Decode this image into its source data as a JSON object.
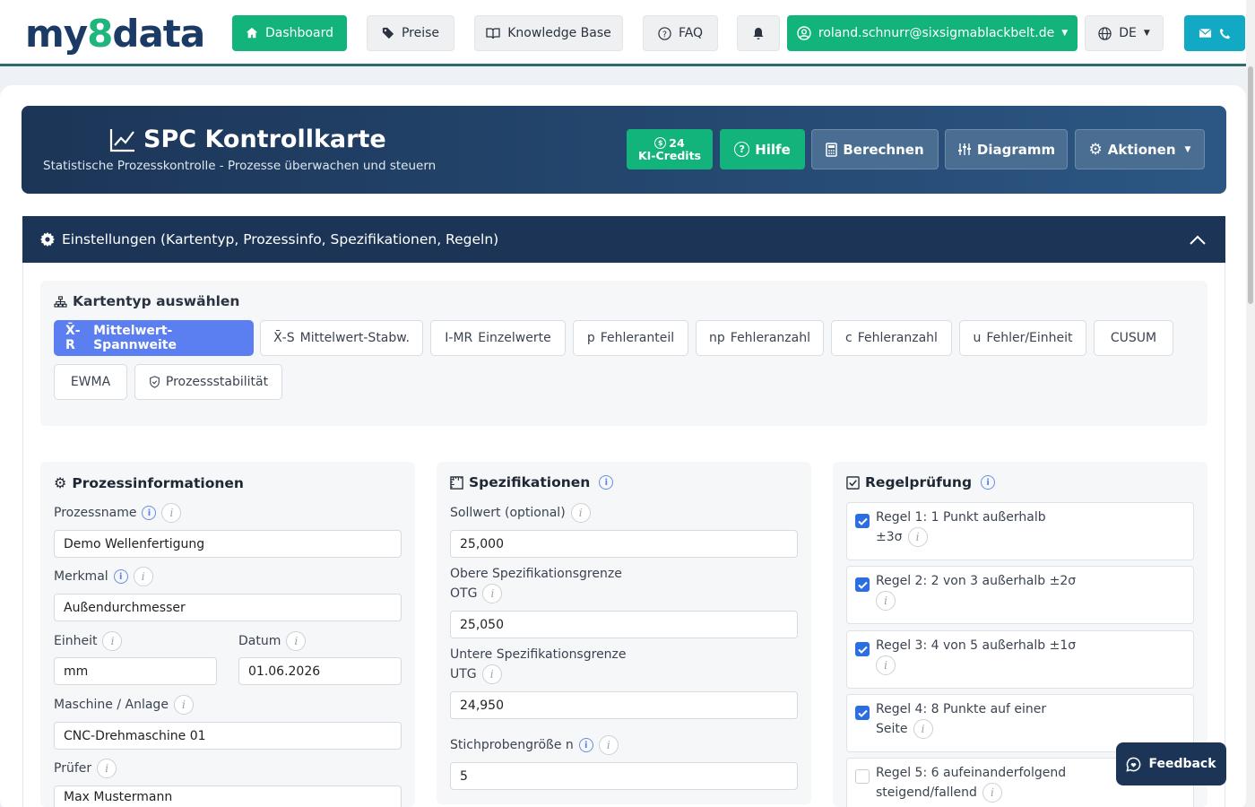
{
  "logo": {
    "prefix": "my",
    "eight": "8",
    "suffix": "data"
  },
  "nav": {
    "dashboard": "Dashboard",
    "preise": "Preise",
    "knowledge_base": "Knowledge Base",
    "faq": "FAQ",
    "user_email": "roland.schnurr@sixsigmablackbelt.de",
    "language": "DE"
  },
  "hero": {
    "title": "SPC Kontrollkarte",
    "subtitle": "Statistische Prozesskontrolle - Prozesse überwachen und steuern",
    "credits_count": "24",
    "credits_label": "KI-Credits",
    "hilfe": "Hilfe",
    "berechnen": "Berechnen",
    "diagramm": "Diagramm",
    "aktionen": "Aktionen"
  },
  "settings": {
    "title": "Einstellungen (Kartentyp, Prozessinfo, Spezifikationen, Regeln)"
  },
  "chart_types": {
    "title": "Kartentyp auswählen",
    "items": [
      {
        "code": "X̄-R",
        "label": "Mittelwert-Spannweite",
        "active": true
      },
      {
        "code": "X̄-S",
        "label": "Mittelwert-Stabw.",
        "active": false
      },
      {
        "code": "I-MR",
        "label": "Einzelwerte",
        "active": false
      },
      {
        "code": "p",
        "label": "Fehleranteil",
        "active": false
      },
      {
        "code": "np",
        "label": "Fehleranzahl",
        "active": false
      },
      {
        "code": "c",
        "label": "Fehleranzahl",
        "active": false
      },
      {
        "code": "u",
        "label": "Fehler/Einheit",
        "active": false
      },
      {
        "code": "",
        "label": "CUSUM",
        "active": false
      },
      {
        "code": "",
        "label": "EWMA",
        "active": false
      },
      {
        "code": "",
        "label": "Prozessstabilität",
        "active": false
      }
    ]
  },
  "process": {
    "title": "Prozessinformationen",
    "name_label": "Prozessname",
    "name_value": "Demo Wellenfertigung",
    "merkmal_label": "Merkmal",
    "merkmal_value": "Außendurchmesser",
    "einheit_label": "Einheit",
    "einheit_value": "mm",
    "datum_label": "Datum",
    "datum_value": "01.06.2026",
    "maschine_label": "Maschine / Anlage",
    "maschine_value": "CNC-Drehmaschine 01",
    "pruefer_label": "Prüfer",
    "pruefer_value": "Max Mustermann"
  },
  "specs": {
    "title": "Spezifikationen",
    "soll_label": "Sollwert (optional)",
    "soll_value": "25,000",
    "otg_label_1": "Obere Spezifikationsgrenze",
    "otg_label_2": "OTG",
    "otg_value": "25,050",
    "utg_label_1": "Untere Spezifikationsgrenze",
    "utg_label_2": "UTG",
    "utg_value": "24,950",
    "n_label": "Stichprobengröße n",
    "n_value": "5"
  },
  "rules": {
    "title": "Regelprüfung",
    "items": [
      {
        "line1": "Regel 1: 1 Punkt außerhalb",
        "line2": "±3σ",
        "checked": true
      },
      {
        "line1": "Regel 2: 2 von 3 außerhalb ±2σ",
        "line2": "",
        "checked": true
      },
      {
        "line1": "Regel 3: 4 von 5 außerhalb ±1σ",
        "line2": "",
        "checked": true
      },
      {
        "line1": "Regel 4: 8 Punkte auf einer",
        "line2": "Seite",
        "checked": true
      },
      {
        "line1": "Regel 5: 6 aufeinanderfolgend",
        "line2": "steigend/fallend",
        "checked": false
      }
    ]
  },
  "feedback": "Feedback",
  "icons": {
    "info": "i",
    "info_blue": "i"
  }
}
